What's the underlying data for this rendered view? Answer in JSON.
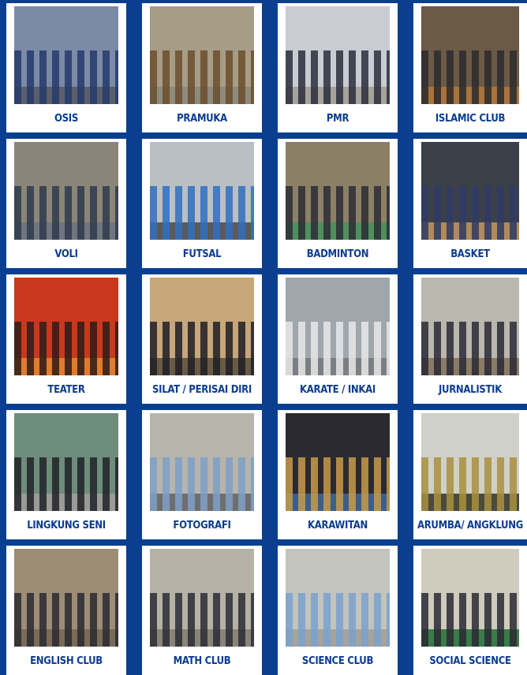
{
  "clubs": [
    {
      "name": "OSIS",
      "bg": "#7b8aa6",
      "accent": "#243a6b",
      "floor": "#5a5f6b"
    },
    {
      "name": "PRAMUKA",
      "bg": "#a79c86",
      "accent": "#6b4e2c",
      "floor": "#8d8a7e"
    },
    {
      "name": "PMR",
      "bg": "#c9ccd2",
      "accent": "#2a2f3d",
      "floor": "#a7a29b"
    },
    {
      "name": "ISLAMIC CLUB",
      "bg": "#6b5a46",
      "accent": "#2c2a2d",
      "floor": "#a8733c"
    },
    {
      "name": "VOLI",
      "bg": "#8a8578",
      "accent": "#2e3a4b",
      "floor": "#6f7680"
    },
    {
      "name": "FUTSAL",
      "bg": "#b9bfc2",
      "accent": "#2f6fc1",
      "floor": "#5a5a5a"
    },
    {
      "name": "BADMINTON",
      "bg": "#8b8066",
      "accent": "#2c2c35",
      "floor": "#4f8f5d"
    },
    {
      "name": "BASKET",
      "bg": "#3b4048",
      "accent": "#2f3a66",
      "floor": "#b08a5a"
    },
    {
      "name": "TEATER",
      "bg": "#c9381c",
      "accent": "#2b1d1a",
      "floor": "#e07c2c"
    },
    {
      "name": "SILAT / PERISAI DIRI",
      "bg": "#c7a67a",
      "accent": "#1e1e24",
      "floor": "#6a5a45"
    },
    {
      "name": "KARATE / INKAI",
      "bg": "#9fa7ad",
      "accent": "#e8e8e8",
      "floor": "#7b7f83"
    },
    {
      "name": "JURNALISTIK",
      "bg": "#b9b7ae",
      "accent": "#2a2a35",
      "floor": "#8a7a66"
    },
    {
      "name": "LINGKUNG SENI",
      "bg": "#6e8c7a",
      "accent": "#1f2228",
      "floor": "#9a9a96"
    },
    {
      "name": "FOTOGRAFI",
      "bg": "#b7b4ab",
      "accent": "#7ea0c8",
      "floor": "#6e6e6e"
    },
    {
      "name": "KARAWITAN",
      "bg": "#2b2a30",
      "accent": "#c79a4a",
      "floor": "#3c5e8a"
    },
    {
      "name": "ARUMBA/ ANGKLUNG",
      "bg": "#cfd0c7",
      "accent": "#a8913d",
      "floor": "#4a4a3d"
    },
    {
      "name": "ENGLISH CLUB",
      "bg": "#9d8c76",
      "accent": "#2a2a2f",
      "floor": "#7a6a58"
    },
    {
      "name": "MATH CLUB",
      "bg": "#b7b2a6",
      "accent": "#2b2d36",
      "floor": "#8a8476"
    },
    {
      "name": "SCIENCE CLUB",
      "bg": "#c2c4bd",
      "accent": "#7aa2cf",
      "floor": "#a6a39b"
    },
    {
      "name": "SOCIAL SCIENCE",
      "bg": "#cfcbbd",
      "accent": "#2a2a33",
      "floor": "#3b7a49"
    }
  ]
}
